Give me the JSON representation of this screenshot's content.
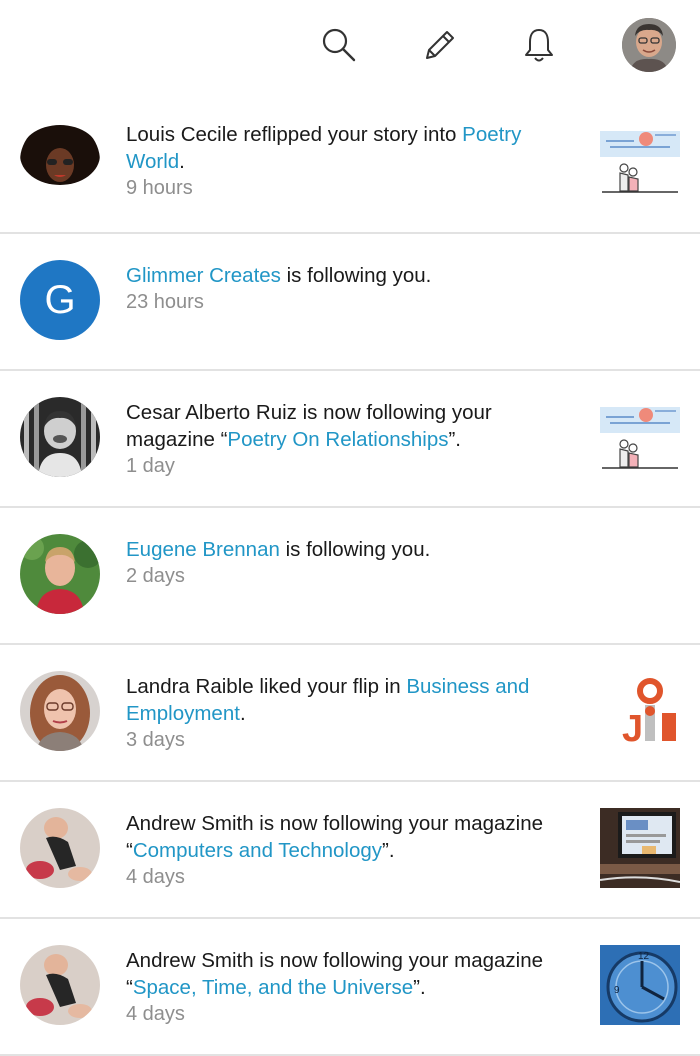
{
  "header": {
    "search_icon": "search-icon",
    "compose_icon": "pencil-icon",
    "notifications_icon": "bell-icon"
  },
  "notifications": [
    {
      "avatar": "afro-avatar",
      "pre": "Louis Cecile reflipped your story into ",
      "link": "Poetry World",
      "post": ".",
      "time": "9 hours",
      "thumb": "poetry-thumbnail"
    },
    {
      "avatar_letter": "G",
      "link": "Glimmer Creates",
      "post": " is following you.",
      "time": "23 hours"
    },
    {
      "pre": "Cesar Alberto Ruiz is now following your magazine “",
      "link": "Poetry On Relationships",
      "post": "”.",
      "time": "1 day",
      "thumb": "poetry-thumbnail"
    },
    {
      "link": "Eugene Brennan",
      "post": " is following you.",
      "time": "2 days"
    },
    {
      "pre": "Landra Raible liked your flip in ",
      "link": "Business and Employment",
      "post": ".",
      "time": "3 days",
      "thumb": "job-thumbnail"
    },
    {
      "pre": "Andrew Smith is now following your magazine “",
      "link": "Computers and Technology",
      "post": "”.",
      "time": "4 days",
      "thumb": "computer-thumbnail"
    },
    {
      "pre": "Andrew Smith is now following your magazine “",
      "link": "Space, Time, and the Universe",
      "post": "”.",
      "time": "4 days",
      "thumb": "clock-thumbnail"
    }
  ],
  "colors": {
    "link": "#2196c6",
    "time": "#8e8e8e",
    "divider": "#e2e2e2",
    "g_avatar": "#1f77c4"
  }
}
